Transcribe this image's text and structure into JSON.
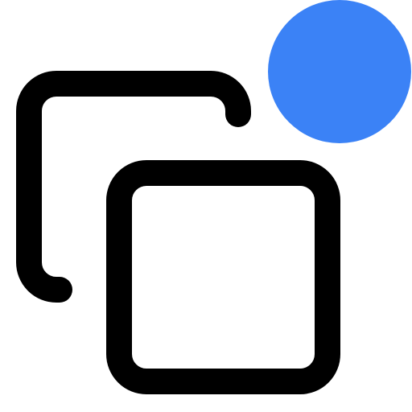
{
  "icon": {
    "name": "copy-icon",
    "stroke_color": "#000000",
    "badge": {
      "name": "notification-dot",
      "color": "#3B82F6"
    }
  }
}
